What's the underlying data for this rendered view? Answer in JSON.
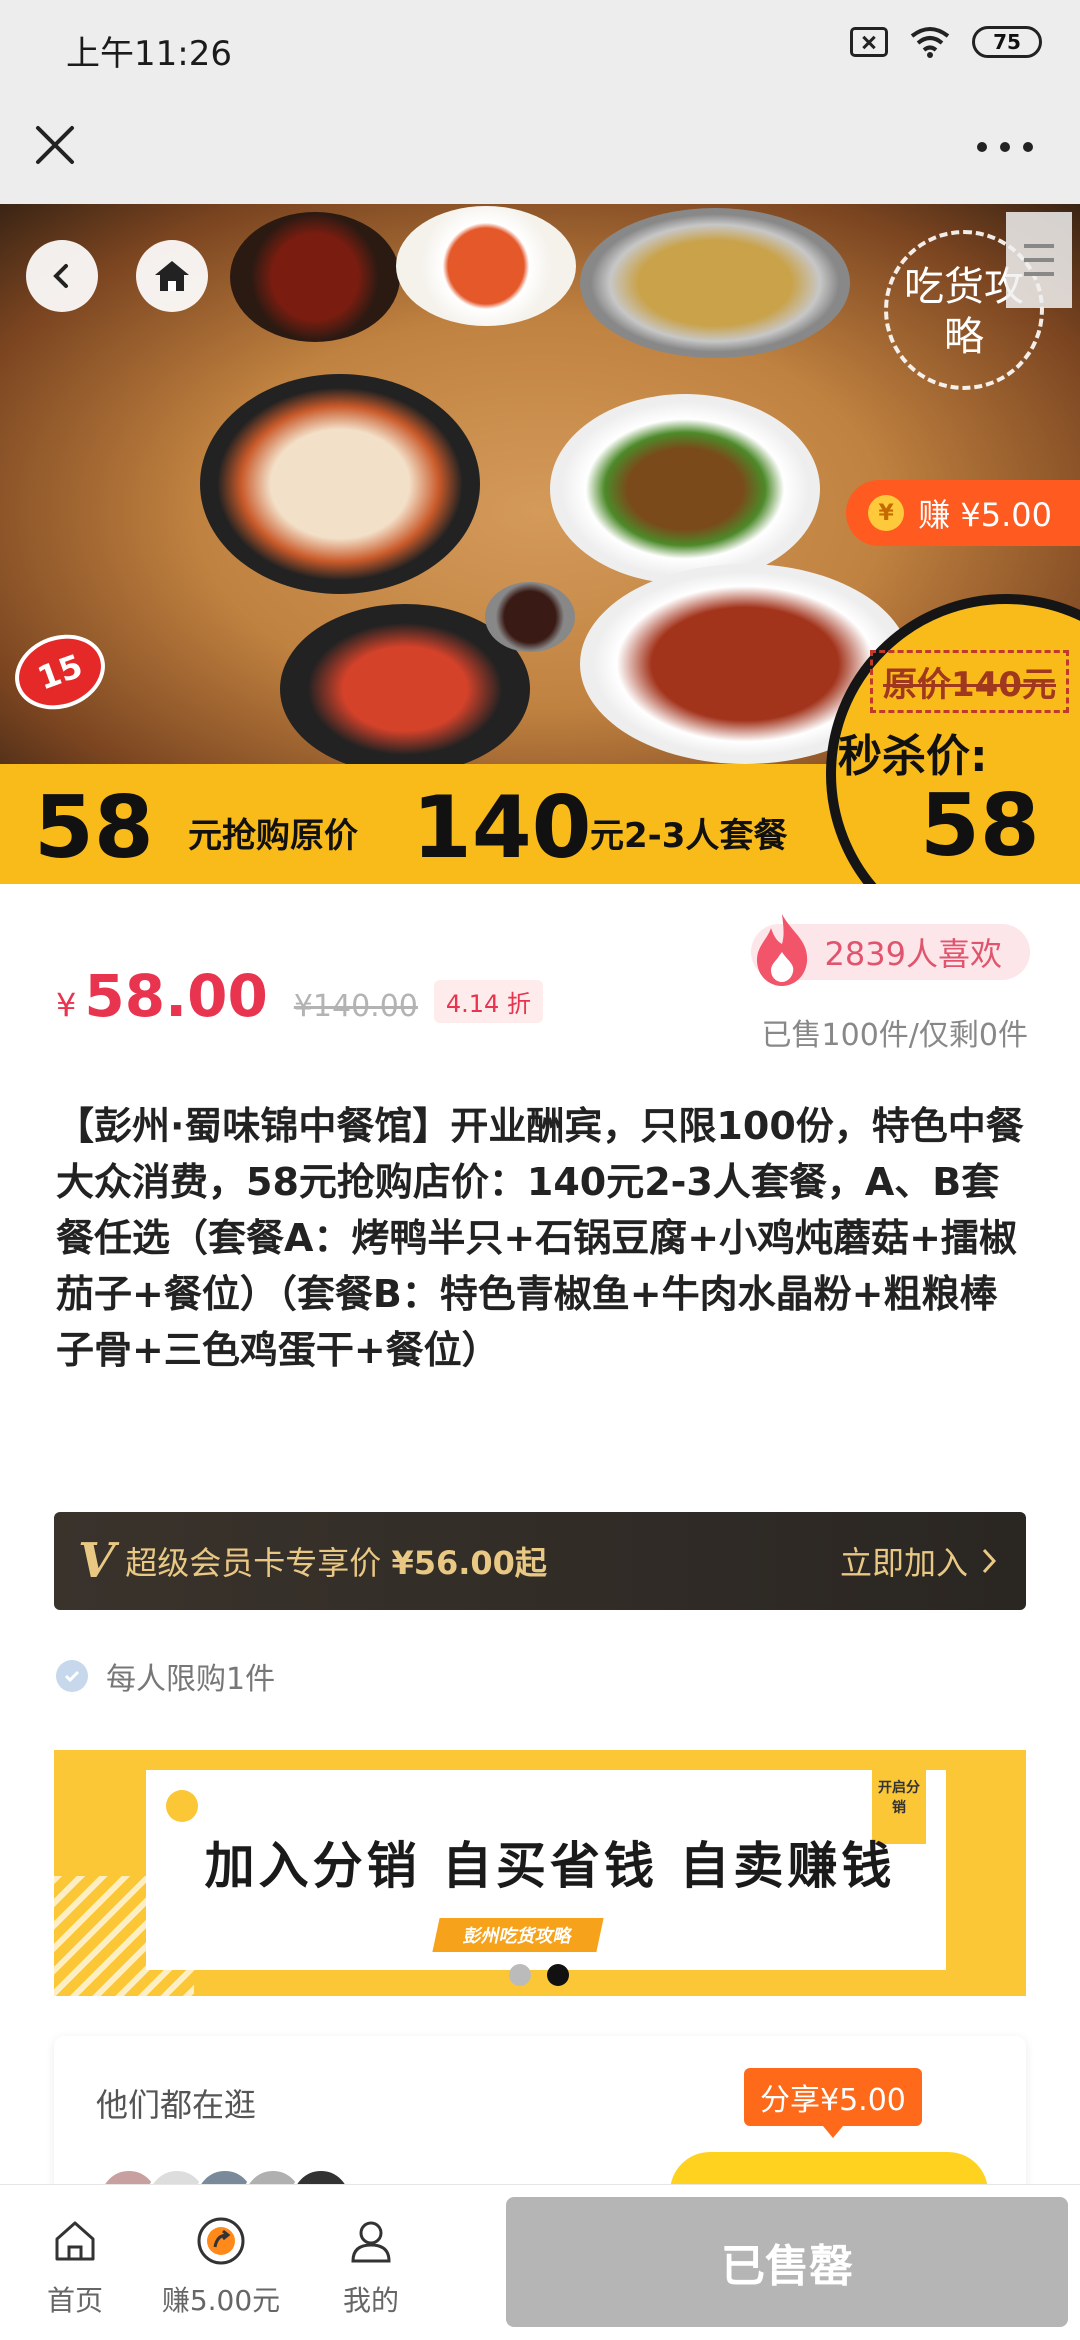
{
  "status_bar": {
    "time": "上午11:26",
    "battery": "75"
  },
  "hero": {
    "badge_chihuo": "吃货攻略",
    "earn_badge": "赚 ¥5.00",
    "coin": "¥",
    "table_number": "15",
    "strip_num1": "58",
    "strip_text1": "元抢购原价",
    "strip_num2": "140",
    "strip_text2": "元2-3人套餐",
    "flash_original": "原价140元",
    "flash_label": "秒杀价:",
    "flash_price": "58"
  },
  "product": {
    "currency": "¥",
    "price": "58.00",
    "original_price": "¥140.00",
    "discount": "4.14 折",
    "likes": "2839人喜欢",
    "sold": "已售100件/仅剩0件",
    "title": "【彭州·蜀味锦中餐馆】开业酬宾，只限100份，特色中餐大众消费，58元抢购店价：140元2-3人套餐，A、B套餐任选（套餐A：烤鸭半只+石锅豆腐+小鸡炖蘑菇+擂椒茄子+餐位）（套餐B：特色青椒鱼+牛肉水晶粉+粗粮棒子骨+三色鸡蛋干+餐位）"
  },
  "vip": {
    "logo": "V",
    "text_prefix": "超级会员卡专享价",
    "text_price": "¥56.00起",
    "join": "立即加入"
  },
  "limit": {
    "text": "每人限购1件"
  },
  "promo": {
    "headline": "加入分销  自买省钱  自卖赚钱",
    "sub": "彭州吃货攻略",
    "tag": "开启分销"
  },
  "browsing": {
    "label": "他们都在逛",
    "share_badge": "分享¥5.00"
  },
  "bottom_bar": {
    "tabs": [
      {
        "label": "首页"
      },
      {
        "label": "赚5.00元"
      },
      {
        "label": "我的"
      }
    ],
    "action": "已售罄"
  }
}
